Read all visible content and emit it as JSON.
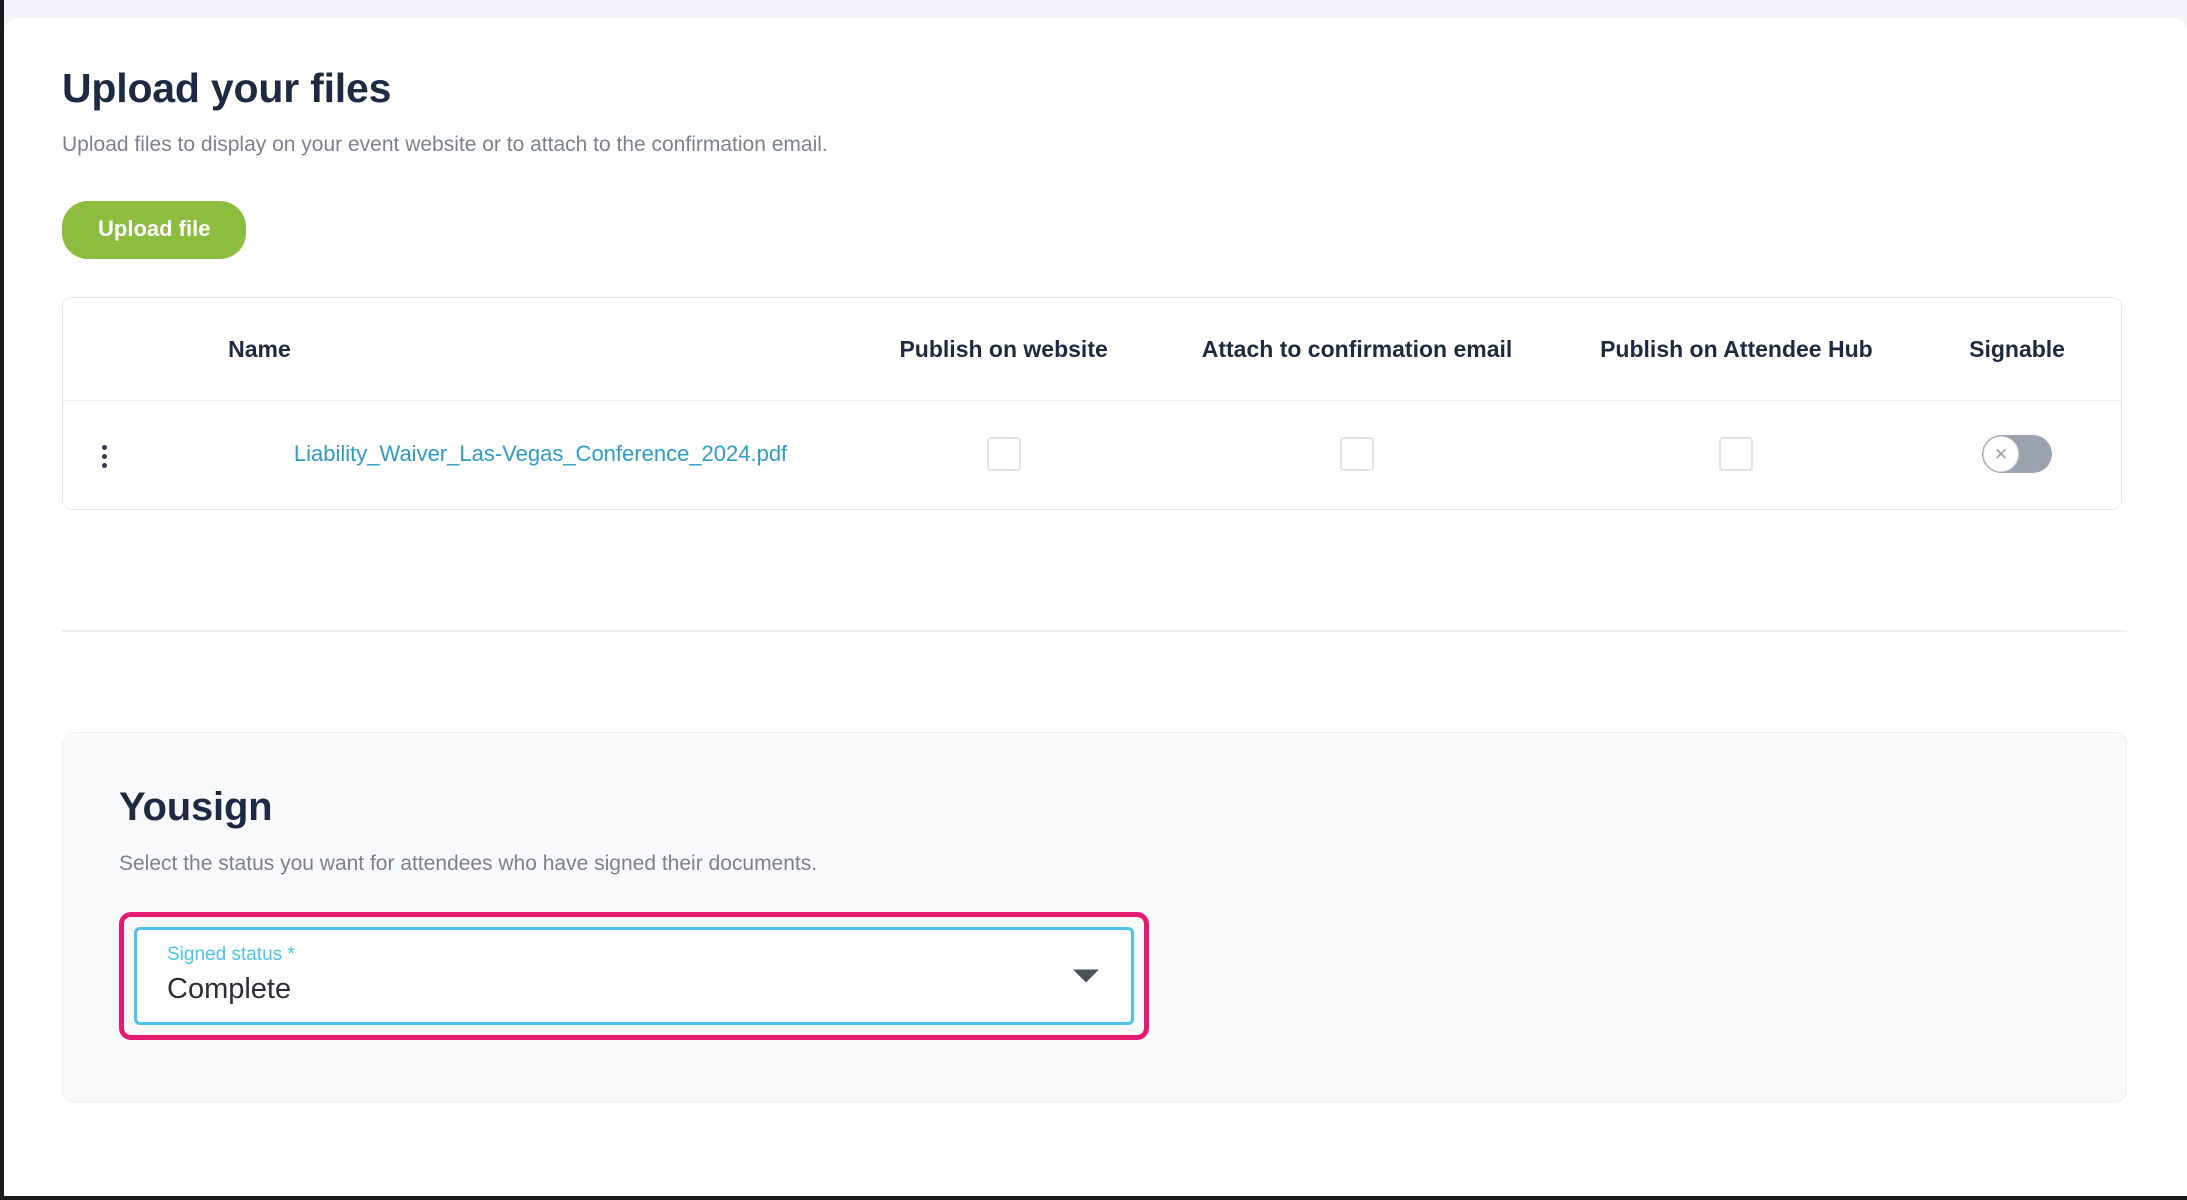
{
  "upload_section": {
    "title": "Upload your files",
    "subtitle": "Upload files to display on your event website or to attach to the confirmation email.",
    "upload_button_label": "Upload file",
    "table": {
      "headers": {
        "name": "Name",
        "publish_website": "Publish on website",
        "attach_email": "Attach to confirmation email",
        "publish_hub": "Publish on Attendee Hub",
        "signable": "Signable"
      },
      "rows": [
        {
          "name": "Liability_Waiver_Las-Vegas_Conference_2024.pdf",
          "publish_website_checked": false,
          "attach_email_checked": false,
          "publish_hub_checked": false,
          "signable_on": false,
          "signable_glyph": "✕",
          "menu_icon": "kebab-menu-icon"
        }
      ]
    }
  },
  "yousign_section": {
    "title": "Yousign",
    "description": "Select the status you want for attendees who have signed their documents.",
    "signed_status_field": {
      "label": "Signed status *",
      "value": "Complete",
      "dropdown_icon": "chevron-down-icon"
    }
  },
  "colors": {
    "accent_green": "#8cbd3f",
    "link_teal": "#2e9cc4",
    "focus_cyan": "#4cc3ea",
    "highlight_pink": "#e51a72",
    "heading_navy": "#1d2b42",
    "muted_gray": "#7b828e"
  }
}
